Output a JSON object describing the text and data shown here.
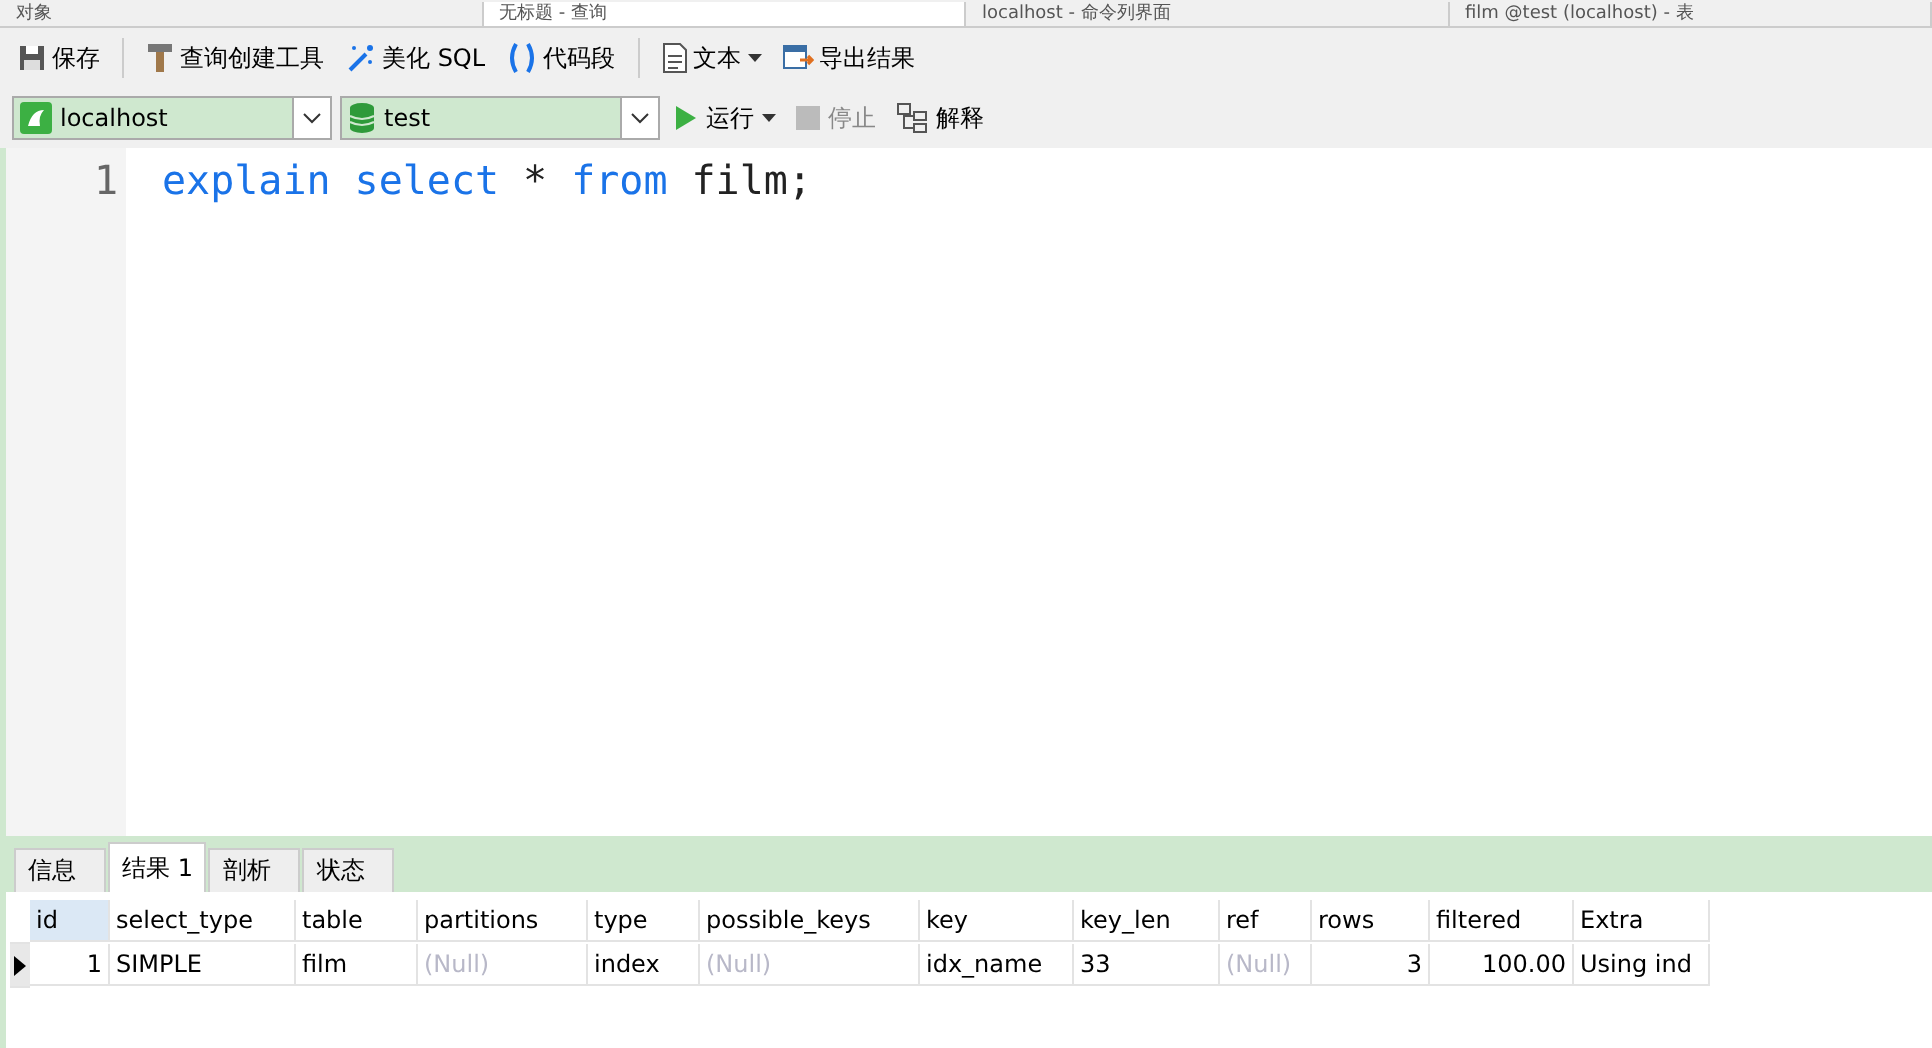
{
  "doc_tabs": [
    {
      "label": "对象",
      "selected": false
    },
    {
      "label": "无标题 - 查询",
      "selected": true
    },
    {
      "label": "localhost - 命令列界面",
      "selected": false
    },
    {
      "label": "film @test (localhost) - 表",
      "selected": false
    }
  ],
  "toolbar": [
    {
      "kind": "save",
      "label": "保存"
    },
    {
      "kind": "sep"
    },
    {
      "kind": "builder",
      "label": "查询创建工具"
    },
    {
      "kind": "beautify",
      "label": "美化 SQL"
    },
    {
      "kind": "snippet",
      "label": "代码段"
    },
    {
      "kind": "sep"
    },
    {
      "kind": "text",
      "label": "文本",
      "dropdown": true
    },
    {
      "kind": "export",
      "label": "导出结果"
    }
  ],
  "connection": {
    "value": "localhost"
  },
  "database": {
    "value": "test"
  },
  "actions": [
    {
      "kind": "run",
      "label": "运行",
      "dropdown": true,
      "disabled": false
    },
    {
      "kind": "stop",
      "label": "停止",
      "disabled": true
    },
    {
      "kind": "explain",
      "label": "解释",
      "disabled": false
    }
  ],
  "editor": {
    "lines": [
      {
        "number": "1",
        "tokens": [
          {
            "text": "explain",
            "kind": "keyword"
          },
          {
            "text": "select",
            "kind": "keyword"
          },
          {
            "text": "*",
            "kind": "plain"
          },
          {
            "text": "from",
            "kind": "keyword"
          },
          {
            "text": "film;",
            "kind": "plain"
          }
        ]
      }
    ]
  },
  "result_tabs": [
    {
      "label": "信息",
      "selected": false
    },
    {
      "label": "结果 1",
      "selected": true
    },
    {
      "label": "剖析",
      "selected": false
    },
    {
      "label": "状态",
      "selected": false
    }
  ],
  "table": {
    "columns": [
      {
        "label": "id",
        "numeric": true,
        "selected": true
      },
      {
        "label": "select_type",
        "numeric": false,
        "selected": false
      },
      {
        "label": "table",
        "numeric": false,
        "selected": false
      },
      {
        "label": "partitions",
        "numeric": false,
        "selected": false
      },
      {
        "label": "type",
        "numeric": false,
        "selected": false
      },
      {
        "label": "possible_keys",
        "numeric": false,
        "selected": false
      },
      {
        "label": "key",
        "numeric": false,
        "selected": false
      },
      {
        "label": "key_len",
        "numeric": false,
        "selected": false
      },
      {
        "label": "ref",
        "numeric": false,
        "selected": false
      },
      {
        "label": "rows",
        "numeric": true,
        "selected": false
      },
      {
        "label": "filtered",
        "numeric": true,
        "selected": false
      },
      {
        "label": "Extra",
        "numeric": false,
        "selected": false
      }
    ],
    "rows": [
      {
        "current": true,
        "cells": [
          {
            "text": "1",
            "null": false
          },
          {
            "text": "SIMPLE",
            "null": false
          },
          {
            "text": "film",
            "null": false
          },
          {
            "text": "(Null)",
            "null": true
          },
          {
            "text": "index",
            "null": false
          },
          {
            "text": "(Null)",
            "null": true
          },
          {
            "text": "idx_name",
            "null": false
          },
          {
            "text": "33",
            "null": false
          },
          {
            "text": "(Null)",
            "null": true
          },
          {
            "text": "3",
            "null": false
          },
          {
            "text": "100.00",
            "null": false
          },
          {
            "text": "Using ind",
            "null": false
          }
        ]
      }
    ]
  }
}
